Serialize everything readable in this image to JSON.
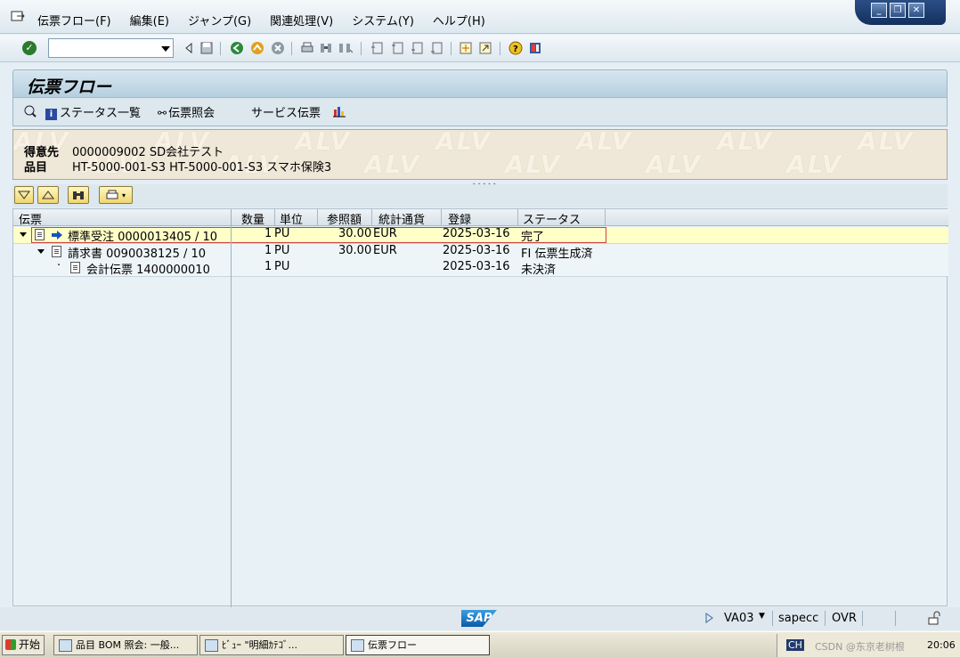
{
  "menu": {
    "items": [
      "伝票フロー(F)",
      "編集(E)",
      "ジャンプ(G)",
      "関連処理(V)",
      "システム(Y)",
      "ヘルプ(H)"
    ]
  },
  "window_controls": {
    "minimize": "_",
    "restore": "❐",
    "close": "✕"
  },
  "toolbar": {
    "command_field": ""
  },
  "title": "伝票フロー",
  "app_toolbar": {
    "status_overview": "ステータス一覧",
    "doc_display": "伝票照会",
    "service_doc": "サービス伝票"
  },
  "header": {
    "customer_label": "得意先",
    "customer_value": "0000009002 SD会社テスト",
    "material_label": "品目",
    "material_value": "HT-5000-001-S3 HT-5000-001-S3 スマホ保険3",
    "watermark": "ALV"
  },
  "grid": {
    "columns": [
      "伝票",
      "数量",
      "単位",
      "参照額",
      "統計通貨",
      "登録",
      "ステータス"
    ],
    "rows": [
      {
        "doc": "標準受注 0000013405 / 10",
        "qty": "1",
        "unit": "PU",
        "amount": "30.00",
        "currency": "EUR",
        "date": "2025-03-16",
        "status": "完了"
      },
      {
        "doc": "請求書 0090038125 / 10",
        "qty": "1",
        "unit": "PU",
        "amount": "30.00",
        "currency": "EUR",
        "date": "2025-03-16",
        "status": "FI 伝票生成済"
      },
      {
        "doc": "会計伝票 1400000010",
        "qty": "1",
        "unit": "PU",
        "amount": "",
        "currency": "",
        "date": "2025-03-16",
        "status": "未決済"
      }
    ]
  },
  "statusbar": {
    "transaction": "VA03",
    "server": "sapecc",
    "mode": "OVR",
    "logo": "SAP"
  },
  "taskbar": {
    "start": "开始",
    "tasks": [
      "品目 BOM 照会: 一般...",
      "ﾋﾞｭｰ \"明細ｶﾃｺﾞ...",
      "伝票フロー"
    ],
    "tray_text": "CSDN @东京老树根",
    "tray_ch": "CH",
    "clock": "20:06"
  }
}
